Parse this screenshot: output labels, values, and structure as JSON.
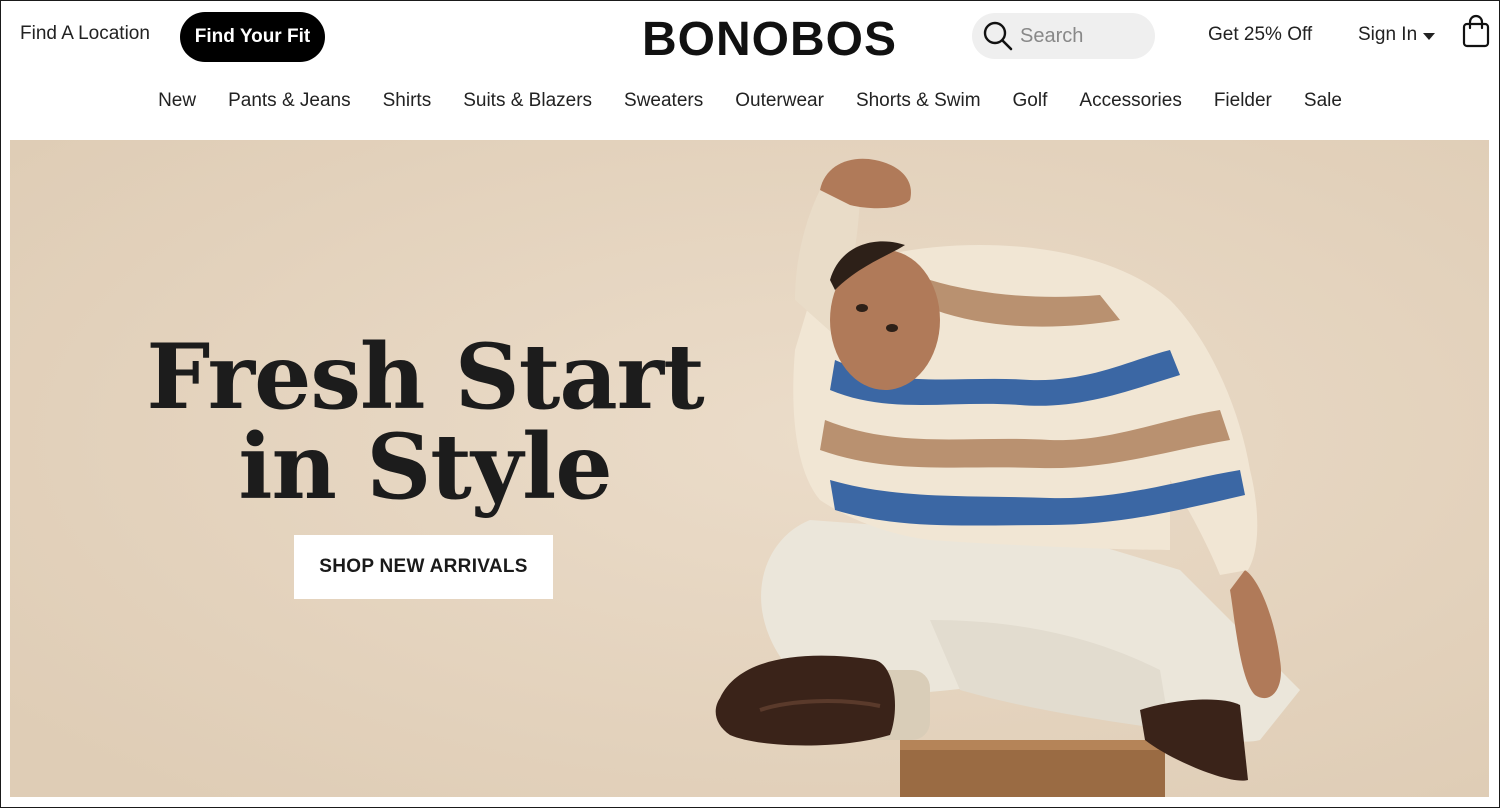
{
  "header": {
    "find_location": "Find A Location",
    "find_fit": "Find Your Fit",
    "brand": "BONOBOS",
    "search_placeholder": "Search",
    "promo": "Get 25% Off",
    "sign_in": "Sign In",
    "icons": {
      "search": "search-icon",
      "cart": "shopping-bag-icon",
      "dropdown": "caret-down-icon"
    }
  },
  "nav": {
    "items": [
      "New",
      "Pants & Jeans",
      "Shirts",
      "Suits & Blazers",
      "Sweaters",
      "Outerwear",
      "Shorts & Swim",
      "Golf",
      "Accessories",
      "Fielder",
      "Sale"
    ]
  },
  "hero": {
    "title_line1": "Fresh Start",
    "title_line2": "in Style",
    "cta": "SHOP NEW ARRIVALS",
    "image": "hero-model-image",
    "colors": {
      "background": "#e5d5c1",
      "accent": "#000000"
    }
  }
}
